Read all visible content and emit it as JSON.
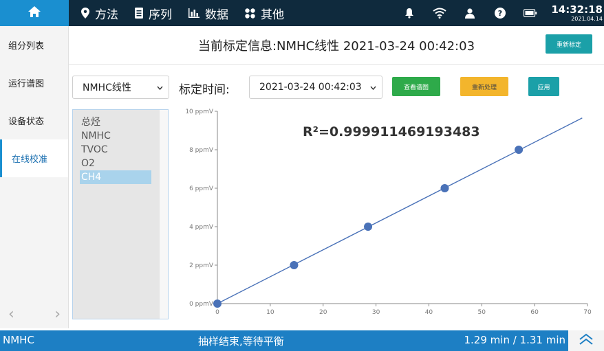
{
  "topbar": {
    "nav": [
      {
        "label": "方法",
        "icon": "location-pin-icon"
      },
      {
        "label": "序列",
        "icon": "document-icon"
      },
      {
        "label": "数据",
        "icon": "bar-chart-icon"
      },
      {
        "label": "其他",
        "icon": "grid-icon"
      }
    ],
    "time": "14:32:18",
    "date": "2021.04.14"
  },
  "sidebar": {
    "items": [
      {
        "label": "组分列表"
      },
      {
        "label": "运行谱图"
      },
      {
        "label": "设备状态"
      },
      {
        "label": "在线校准",
        "active": true
      }
    ],
    "prev_arrow": "‹",
    "next_arrow": "›"
  },
  "header": {
    "title": "当前标定信息:NMHC线性 2021-03-24 00:42:03",
    "recalibrate_label": "重新标定"
  },
  "controls": {
    "component_select": "NMHC线性",
    "time_label": "标定时间:",
    "time_select": "2021-03-24 00:42:03",
    "view_chromatogram_label": "查看谱图",
    "reprocess_label": "重新处理",
    "apply_label": "应用"
  },
  "component_list": {
    "items": [
      "总烃",
      "NMHC",
      "TVOC",
      "O2",
      "CH4"
    ],
    "selected_index": 4
  },
  "chart_data": {
    "type": "scatter",
    "annotation": "R²=0.999911469193483",
    "x": [
      0,
      14.5,
      28.5,
      43,
      57
    ],
    "y": [
      0,
      2,
      4,
      6,
      8
    ],
    "fit_line": {
      "x": [
        0,
        69
      ],
      "y": [
        0,
        9.65
      ]
    },
    "xlim": [
      0,
      70
    ],
    "ylim": [
      0,
      10
    ],
    "x_ticks": [
      "0",
      "10",
      "20",
      "30",
      "40",
      "50",
      "60",
      "70"
    ],
    "y_ticks": [
      "0 ppmV",
      "2 ppmV",
      "4 ppmV",
      "6 ppmV",
      "8 ppmV",
      "10 ppmV"
    ],
    "grid": false,
    "color": "#4a72b8"
  },
  "statusbar": {
    "component": "NMHC",
    "message": "抽样结束,等待平衡",
    "progress": "1.29 min / 1.31 min"
  }
}
